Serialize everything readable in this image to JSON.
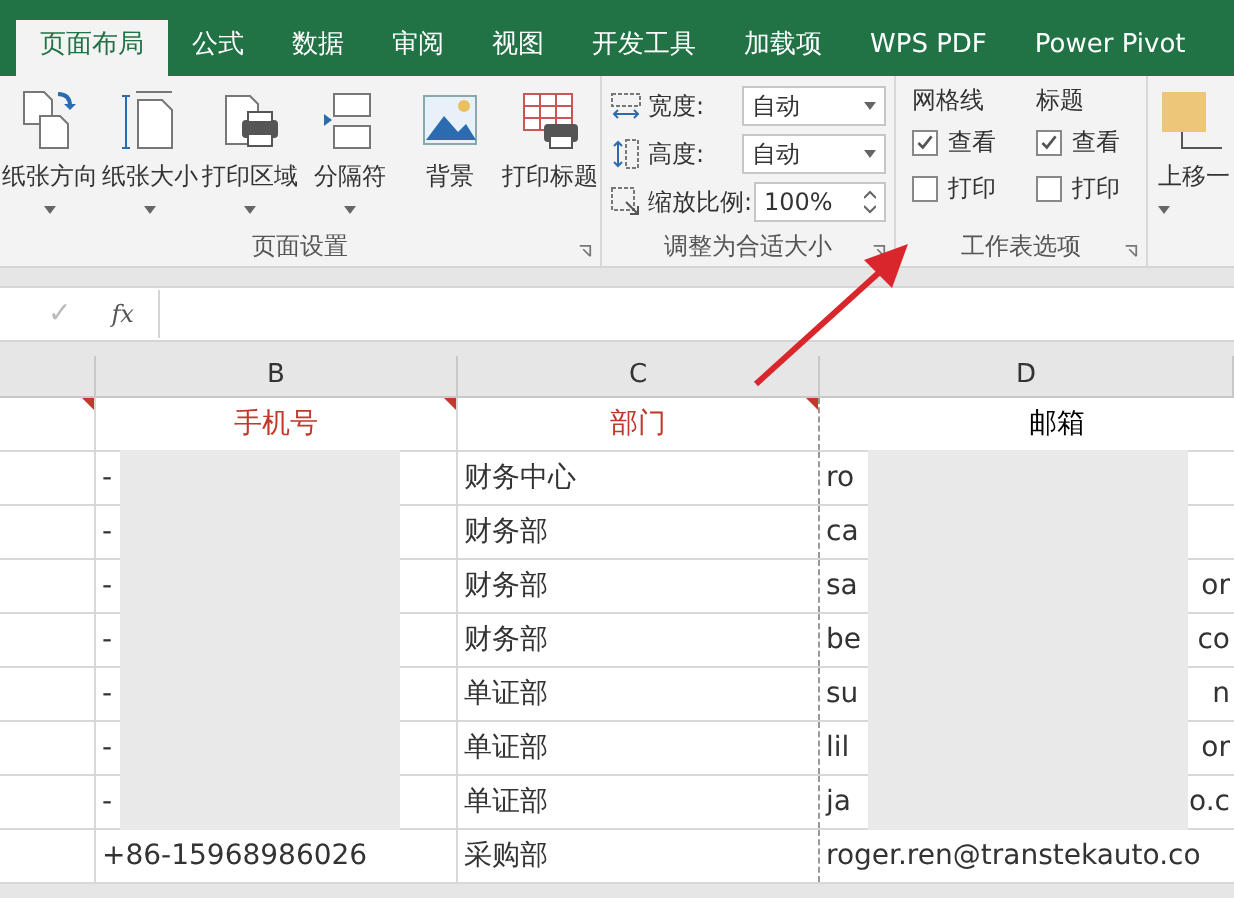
{
  "tabs": [
    {
      "label": "页面布局",
      "selected": true
    },
    {
      "label": "公式",
      "selected": false
    },
    {
      "label": "数据",
      "selected": false
    },
    {
      "label": "审阅",
      "selected": false
    },
    {
      "label": "视图",
      "selected": false
    },
    {
      "label": "开发工具",
      "selected": false
    },
    {
      "label": "加载项",
      "selected": false
    },
    {
      "label": "WPS PDF",
      "selected": false
    },
    {
      "label": "Power Pivot",
      "selected": false
    }
  ],
  "page_setup": {
    "title": "页面设置",
    "buttons": [
      {
        "label": "纸张方向",
        "dropdown": true
      },
      {
        "label": "纸张大小",
        "dropdown": true
      },
      {
        "label": "打印区域",
        "dropdown": true
      },
      {
        "label": "分隔符",
        "dropdown": true
      },
      {
        "label": "背景",
        "dropdown": false
      },
      {
        "label": "打印标题",
        "dropdown": false
      }
    ]
  },
  "scale_to_fit": {
    "title": "调整为合适大小",
    "rows": [
      {
        "label": "宽度:",
        "value": "自动",
        "kind": "dropdown"
      },
      {
        "label": "高度:",
        "value": "自动",
        "kind": "dropdown"
      },
      {
        "label": "缩放比例:",
        "value": "100%",
        "kind": "spinner"
      }
    ]
  },
  "sheet_options": {
    "title": "工作表选项",
    "columns": [
      {
        "heading": "网格线",
        "view": {
          "label": "查看",
          "checked": true
        },
        "print": {
          "label": "打印",
          "checked": false
        }
      },
      {
        "heading": "标题",
        "view": {
          "label": "查看",
          "checked": true
        },
        "print": {
          "label": "打印",
          "checked": false
        }
      }
    ]
  },
  "arrange": {
    "label": "上移一"
  },
  "formula_bar": {
    "confirm_symbol": "✓",
    "function_symbol": "fx"
  },
  "sheet": {
    "columns": [
      {
        "letter": "B"
      },
      {
        "letter": "C"
      },
      {
        "letter": "D"
      }
    ],
    "header_row": [
      {
        "comment": true
      },
      {
        "text": "手机号",
        "color": "#c0392b",
        "comment": true
      },
      {
        "text": "部门",
        "color": "#c0392b",
        "comment": true
      },
      {
        "text": "邮箱",
        "color": "#000000",
        "comment": false
      }
    ],
    "rows": [
      {
        "phone": "-",
        "department": "财务中心",
        "email": "ro",
        "redacted": true
      },
      {
        "phone": "-",
        "department": "财务部",
        "email": "ca",
        "redacted": true
      },
      {
        "phone": "-",
        "department": "财务部",
        "email": "sa",
        "email_tail": "or",
        "redacted": true
      },
      {
        "phone": "-",
        "department": "财务部",
        "email": "be",
        "email_tail": "co",
        "redacted": true
      },
      {
        "phone": "-",
        "department": "单证部",
        "email": "su",
        "email_tail": "n",
        "redacted": true
      },
      {
        "phone": "-",
        "department": "单证部",
        "email": "lil",
        "email_tail": "or",
        "redacted": true
      },
      {
        "phone": "-",
        "department": "单证部",
        "email": "ja",
        "email_tail": "o.c",
        "redacted": true
      },
      {
        "phone": "+86-15968986026",
        "department": "采购部",
        "email": "roger.ren@transtekauto.co",
        "redacted": false
      }
    ]
  }
}
